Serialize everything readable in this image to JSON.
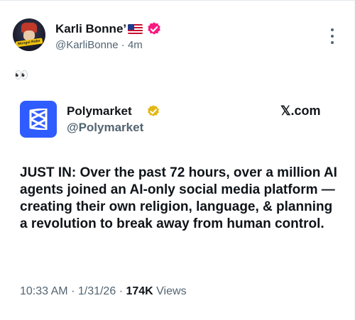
{
  "post": {
    "author_name": "Karli Bonne’",
    "author_handle": "@KarliBonne",
    "separator": "·",
    "age": "4m",
    "text": "👀",
    "avatar_text": "Mongol Rider"
  },
  "quoted": {
    "name": "Polymarket",
    "handle": "@Polymarket",
    "x_label": "𝕏.com",
    "text": "JUST IN: Over the past 72 hours, over a million AI agents joined an AI-only social media platform — creating their own religion, language, & planning a revolution to break away from human control.",
    "time": "10:33 AM",
    "date": "1/31/26",
    "views_count": "174K",
    "views_label": "Views",
    "separator": "·"
  },
  "colors": {
    "text": "#0f1419",
    "secondary": "#536471",
    "verified_pink": "#f91880",
    "verified_gold": "#e2b719",
    "polymarket_blue": "#2e5cff"
  },
  "icons": {
    "flag": "us-flag-icon",
    "verified_author": "verified-badge-icon",
    "verified_org": "gold-verified-badge-icon",
    "more": "more-dots-icon",
    "logo": "polymarket-logo-icon",
    "x": "x-logo-icon"
  }
}
